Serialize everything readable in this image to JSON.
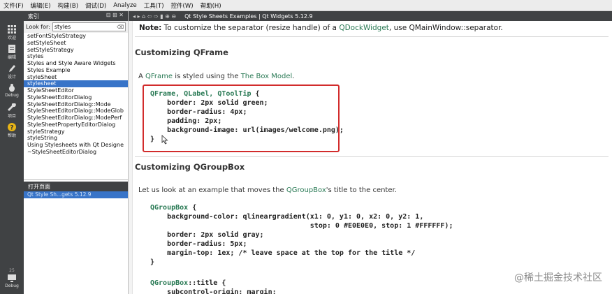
{
  "menubar": [
    "文件(F)",
    "编辑(E)",
    "构建(B)",
    "调试(D)",
    "Analyze",
    "工具(T)",
    "控件(W)",
    "帮助(H)"
  ],
  "modes": [
    {
      "label": "欢迎",
      "icon": "grid-icon"
    },
    {
      "label": "编辑",
      "icon": "document-icon"
    },
    {
      "label": "设计",
      "icon": "pencil-icon"
    },
    {
      "label": "Debug",
      "icon": "bug-icon"
    },
    {
      "label": "项目",
      "icon": "wrench-icon"
    },
    {
      "label": "帮助",
      "icon": "help-icon"
    }
  ],
  "bottom_mode": {
    "number": "25",
    "label": "Debug",
    "icon": "monitor-icon"
  },
  "sidebar": {
    "title": "索引",
    "lookfor_label": "Look for:",
    "search_value": "styles",
    "items": [
      "setFontStyleStrategy",
      "setStyleSheet",
      "setStyleStrategy",
      "styles",
      "Styles and Style Aware Widgets",
      "Styles Example",
      "styleSheet",
      "stylesheet",
      "StyleSheetEditor",
      "StyleSheetEditorDialog",
      "StyleSheetEditorDialog::Mode",
      "StyleSheetEditorDialog::ModeGlob",
      "StyleSheetEditorDialog::ModePerf",
      "StyleSheetPropertyEditorDialog",
      "styleStrategy",
      "styleString",
      "Using Stylesheets with Qt Designe",
      "~StyleSheetEditorDialog"
    ],
    "selected_index": 7,
    "open_pages_title": "打开页面",
    "open_pages": [
      "Qt Style Sh...gets 5.12.9"
    ]
  },
  "doc_title": "Qt Style Sheets Examples | Qt Widgets 5.12.9",
  "content": {
    "note_label": "Note:",
    "note_a": " To customize the separator (resize handle) of a ",
    "note_link1": "QDockWidget",
    "note_b": ", use QMainWindow::separator.",
    "h1": "Customizing QFrame",
    "p1_a": "A ",
    "p1_link1": "QFrame",
    "p1_b": " is styled using the ",
    "p1_link2": "The Box Model",
    "p1_c": ".",
    "code1_sel": "QFrame, QLabel, QToolTip",
    "code1_rest": " {\n    border: 2px solid green;\n    border-radius: 4px;\n    padding: 2px;\n    background-image: url(images/welcome.png);\n}",
    "h2": "Customizing QGroupBox",
    "p2_a": "Let us look at an example that moves the ",
    "p2_link": "QGroupBox",
    "p2_b": "'s title to the center.",
    "code2_sel": "QGroupBox",
    "code2_rest": " {\n    background-color: qlineargradient(x1: 0, y1: 0, x2: 0, y2: 1,\n                                      stop: 0 #E0E0E0, stop: 1 #FFFFFF);\n    border: 2px solid gray;\n    border-radius: 5px;\n    margin-top: 1ex; /* leave space at the top for the title */\n}",
    "code3_sel": "QGroupBox",
    "code3_rest": "::title {\n    subcontrol-origin: margin;"
  },
  "watermark": "@稀土掘金技术社区",
  "colors": {
    "link": "#2a7a55",
    "highlight_box": "#d22c2c",
    "selection": "#3874c8",
    "panel_dark": "#404244"
  }
}
